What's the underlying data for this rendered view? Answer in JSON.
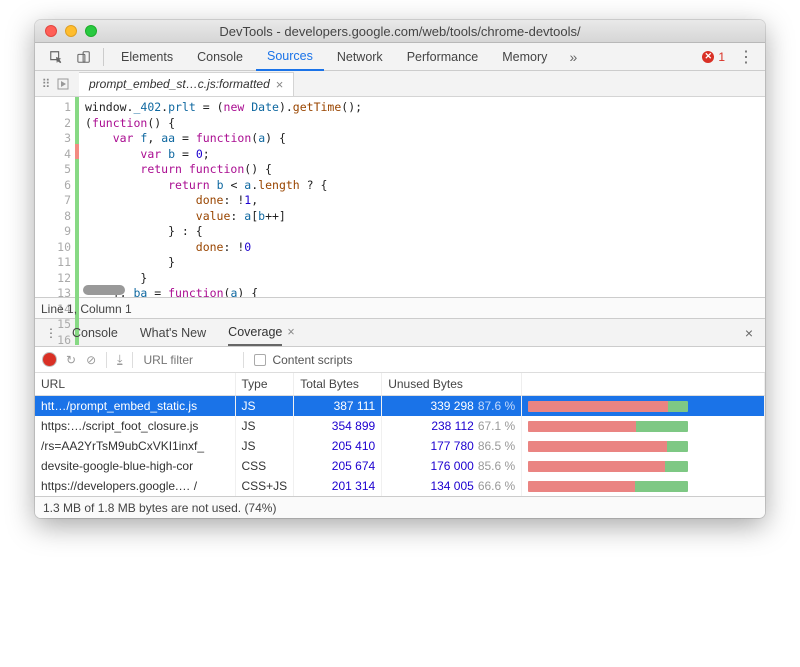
{
  "window": {
    "title": "DevTools - developers.google.com/web/tools/chrome-devtools/"
  },
  "toolbar": {
    "tabs": [
      "Elements",
      "Console",
      "Sources",
      "Network",
      "Performance",
      "Memory"
    ],
    "activeTab": "Sources",
    "errorCount": "1"
  },
  "file_tab": {
    "label": "prompt_embed_st…c.js:formatted",
    "close": "×"
  },
  "code": {
    "lines": 16,
    "coverage": [
      "green",
      "green",
      "green",
      "red",
      "green",
      "green",
      "green",
      "green",
      "green",
      "green",
      "green",
      "green",
      "green",
      "green",
      "green",
      "green"
    ],
    "status": "Line 1, Column 1"
  },
  "drawer": {
    "tabs": [
      "Console",
      "What's New",
      "Coverage"
    ],
    "activeTab": "Coverage",
    "close": "×"
  },
  "cov_toolbar": {
    "filter_placeholder": "URL filter",
    "contentScripts": "Content scripts"
  },
  "cov_headers": [
    "URL",
    "Type",
    "Total Bytes",
    "Unused Bytes",
    ""
  ],
  "cov_rows": [
    {
      "url": "htt…/prompt_embed_static.js",
      "type": "JS",
      "total": "387 111",
      "unused": "339 298",
      "pct": "87.6 %",
      "usedPct": 12.4,
      "selected": true
    },
    {
      "url": "https:…/script_foot_closure.js",
      "type": "JS",
      "total": "354 899",
      "unused": "238 112",
      "pct": "67.1 %",
      "usedPct": 32.9
    },
    {
      "url": "/rs=AA2YrTsM9ubCxVKI1inxf_",
      "type": "JS",
      "total": "205 410",
      "unused": "177 780",
      "pct": "86.5 %",
      "usedPct": 13.5
    },
    {
      "url": "devsite-google-blue-high-cor",
      "type": "CSS",
      "total": "205 674",
      "unused": "176 000",
      "pct": "85.6 %",
      "usedPct": 14.4
    },
    {
      "url": "https://developers.google.… /",
      "type": "CSS+JS",
      "total": "201 314",
      "unused": "134 005",
      "pct": "66.6 %",
      "usedPct": 33.4
    }
  ],
  "footer": "1.3 MB of 1.8 MB bytes are not used. (74%)"
}
